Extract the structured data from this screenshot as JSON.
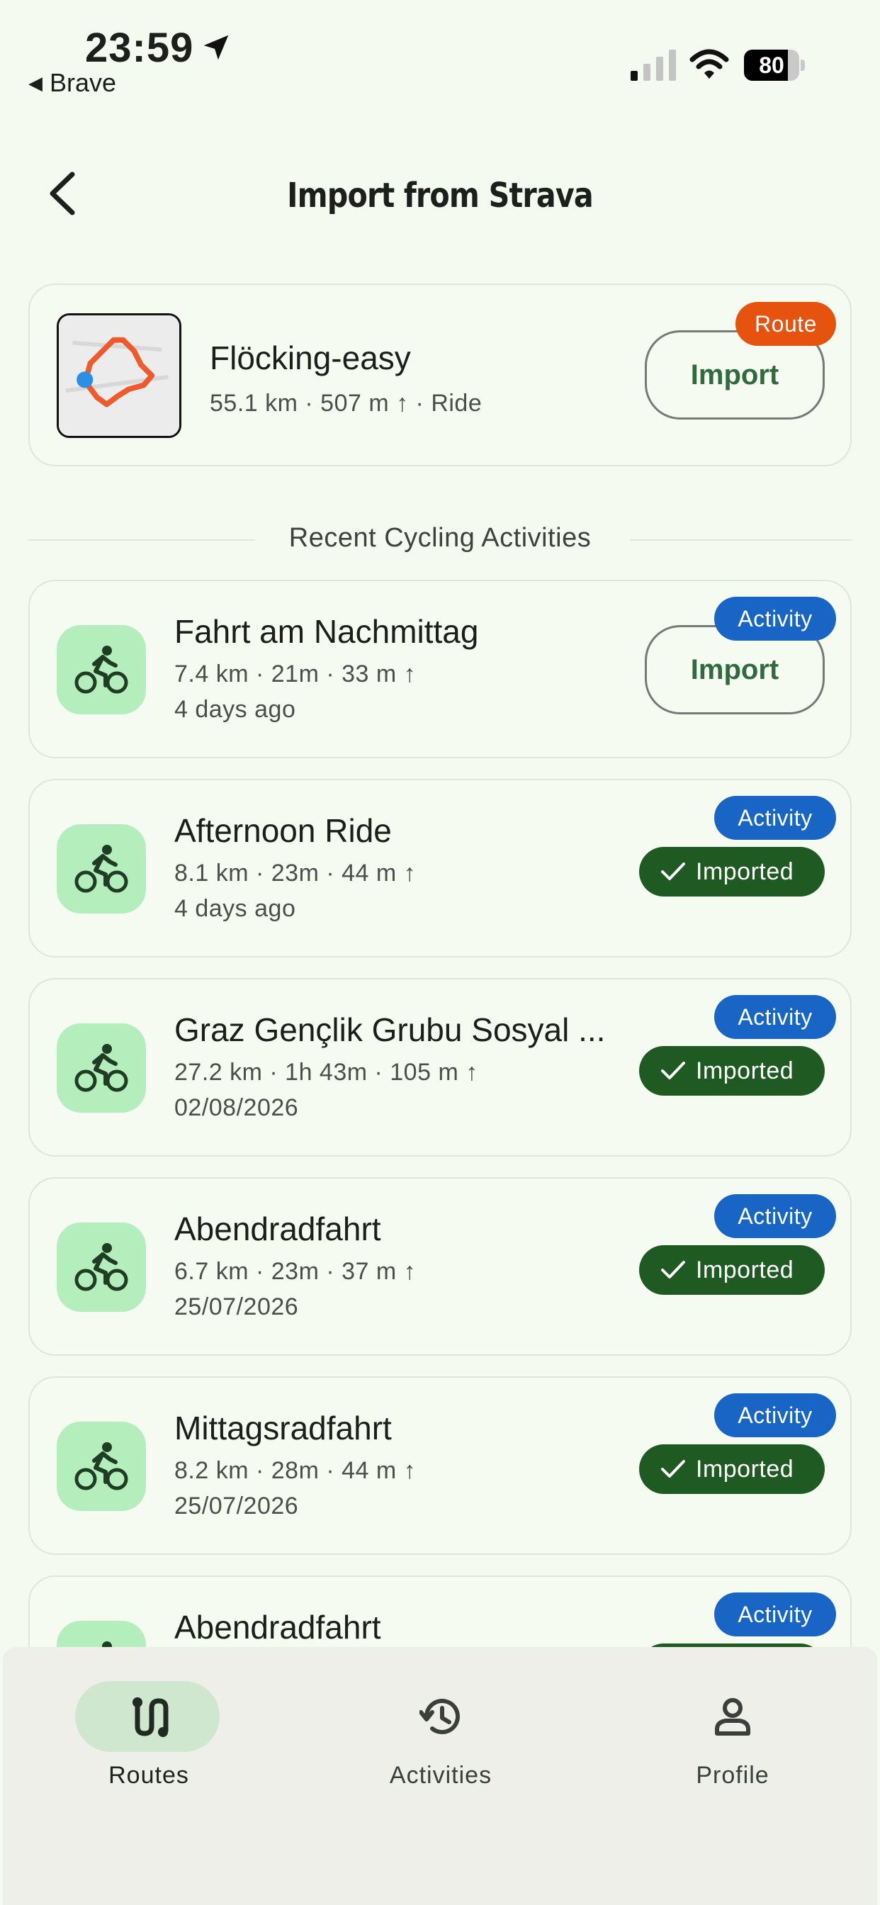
{
  "status_bar": {
    "time": "23:59",
    "back_app": "Brave",
    "battery": "80",
    "battery_level": 0.8
  },
  "header": {
    "title": "Import from Strava"
  },
  "route_card": {
    "name": "Flöcking-easy",
    "meta": "55.1 km · 507 m ↑ · Ride",
    "badge": "Route",
    "button": "Import"
  },
  "section": {
    "title": "Recent Cycling Activities"
  },
  "activities": [
    {
      "name": "Fahrt am Nachmittag",
      "stats": "7.4 km · 21m · 33 m ↑",
      "date": "4 days ago",
      "badge": "Activity",
      "action": "Import",
      "state": "import"
    },
    {
      "name": "Afternoon Ride",
      "stats": "8.1 km · 23m · 44 m ↑",
      "date": "4 days ago",
      "badge": "Activity",
      "action": "Imported",
      "state": "imported"
    },
    {
      "name": "Graz Gençlik Grubu Sosyal ...",
      "stats": "27.2 km · 1h 43m · 105 m ↑",
      "date": "02/08/2026",
      "badge": "Activity",
      "action": "Imported",
      "state": "imported"
    },
    {
      "name": "Abendradfahrt",
      "stats": "6.7 km · 23m · 37 m ↑",
      "date": "25/07/2026",
      "badge": "Activity",
      "action": "Imported",
      "state": "imported"
    },
    {
      "name": "Mittagsradfahrt",
      "stats": "8.2 km · 28m · 44 m ↑",
      "date": "25/07/2026",
      "badge": "Activity",
      "action": "Imported",
      "state": "imported"
    },
    {
      "name": "Abendradfahrt",
      "stats": "",
      "date": "",
      "badge": "Activity",
      "action": "",
      "state": "imported"
    }
  ],
  "nav": [
    {
      "label": "Routes",
      "icon": "route-icon",
      "active": true
    },
    {
      "label": "Activities",
      "icon": "history-icon",
      "active": false
    },
    {
      "label": "Profile",
      "icon": "person-icon",
      "active": false
    }
  ],
  "colors": {
    "background": "#f5faf1",
    "route_badge": "#e6530f",
    "activity_badge": "#1865c6",
    "imported_pill": "#1f5a22",
    "activity_icon_bg": "#b5eebd",
    "route_line": "#ef5a2a",
    "nav_active_pill": "#cfe6cf"
  }
}
